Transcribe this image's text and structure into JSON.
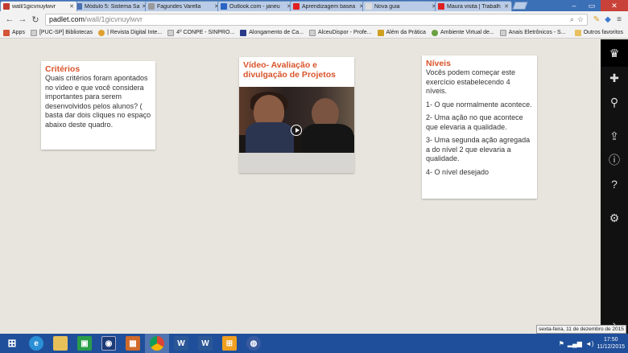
{
  "browser": {
    "tabs": [
      {
        "title": "wall/1gicvnuylwvr",
        "color": "#c23b2e",
        "active": true
      },
      {
        "title": "Módulo 5: Sistema Sa",
        "color": "#4b6fb0",
        "active": false
      },
      {
        "title": "Fagundes Varella",
        "color": "#9a9a9a",
        "active": false
      },
      {
        "title": "Outlook.com - janeu",
        "color": "#2a64c4",
        "active": false
      },
      {
        "title": "Aprendizagem basea",
        "color": "#e02020",
        "active": false
      },
      {
        "title": "Nova guia",
        "color": "#cccccc",
        "active": false
      },
      {
        "title": "Maura visita | Trabalh",
        "color": "#e02020",
        "active": false
      }
    ],
    "url_host": "padlet.com",
    "url_path": "/wall/1gicvnuylwvr",
    "bookmarks": [
      {
        "label": "Apps",
        "color": "#d4553a"
      },
      {
        "label": "[PUC-SP] Bibliotecas",
        "color": "#cfcfcf"
      },
      {
        "label": "| Revista Digital Inte...",
        "color": "#e0a030"
      },
      {
        "label": "4º CONPE - SINPRO...",
        "color": "#cfcfcf"
      },
      {
        "label": "Alongamento de Ca...",
        "color": "#2a3a8a"
      },
      {
        "label": "AlceuDispor - Profe...",
        "color": "#cfcfcf"
      },
      {
        "label": "Além da Prática",
        "color": "#d0a020"
      },
      {
        "label": "Ambiente Virtual de...",
        "color": "#6aa040"
      },
      {
        "label": "Anais Eletrônicos - S...",
        "color": "#cfcfcf"
      }
    ],
    "other_bookmarks": "Outros favoritos"
  },
  "cards": {
    "criterios": {
      "title": "Critérios",
      "body": "Quais critérios foram apontados no vídeo e que você considera importantes para serem desenvolvidos pelos alunos? ( basta dar dois cliques  no espaço abaixo deste quadro."
    },
    "video": {
      "title": "Vídeo- Avaliação e divulgação de Projetos"
    },
    "niveis": {
      "title": "Níveis",
      "paragraphs": [
        "Vocês podem começar este exercício estabelecendo 4 níveis.",
        "1- O que normalmente acontece.",
        "2- Uma ação no que acontece que elevaria a qualidade.",
        "3-  Uma segunda ação agregada a do nível 2 que elevaria a qualidade.",
        "4- O nível desejado"
      ]
    }
  },
  "tooltip": {
    "date": "sexta-feira, 11 de dezembro de 2015"
  },
  "taskbar": {
    "time": "17:50",
    "date": "11/12/2015"
  },
  "colors": {
    "accent": "#d9542b",
    "taskbar": "#1f4f9a"
  }
}
